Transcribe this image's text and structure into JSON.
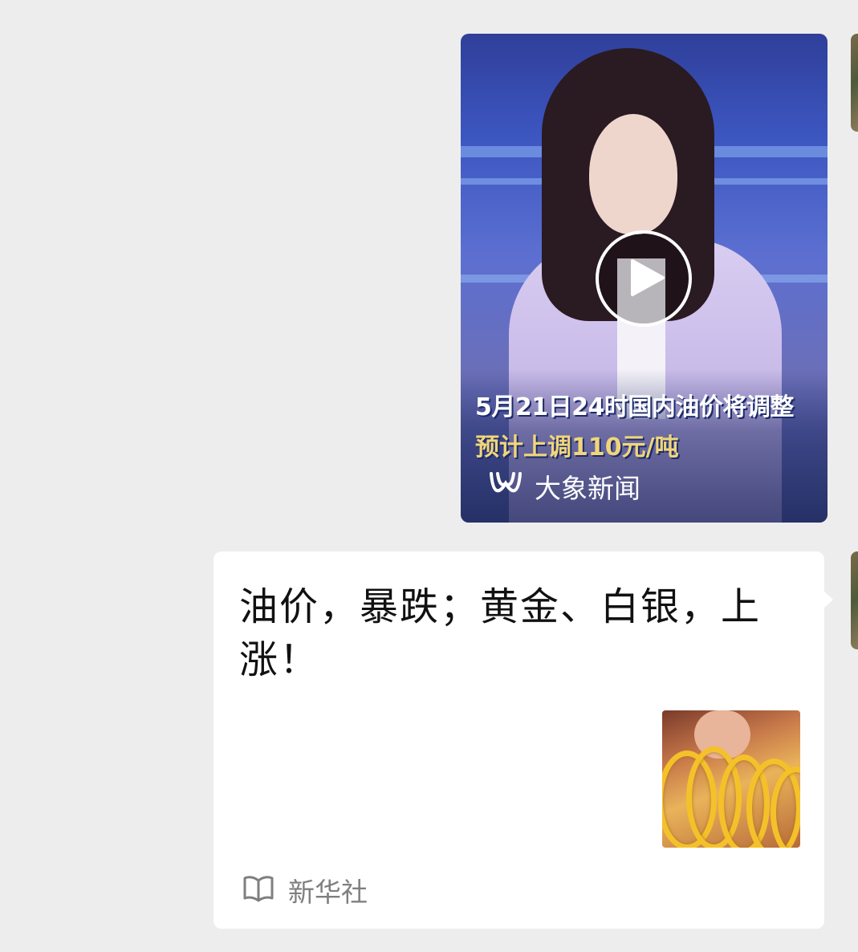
{
  "video_message": {
    "caption_line1": "5月21日24时国内油价将调整",
    "caption_line2": "预计上调110元/吨",
    "source_name": "大象新闻",
    "source_logo_icon": "daxiang-news-logo-icon",
    "play_icon": "play-icon"
  },
  "article_message": {
    "title": "油价，暴跌；黄金、白银，上涨！",
    "source_name": "新华社",
    "source_icon": "book-icon",
    "thumbnail_subject": "gold-bangles-image"
  },
  "colors": {
    "chat_background": "#ededed",
    "caption_highlight": "#f0d57a",
    "source_text": "#7f7f7f"
  }
}
